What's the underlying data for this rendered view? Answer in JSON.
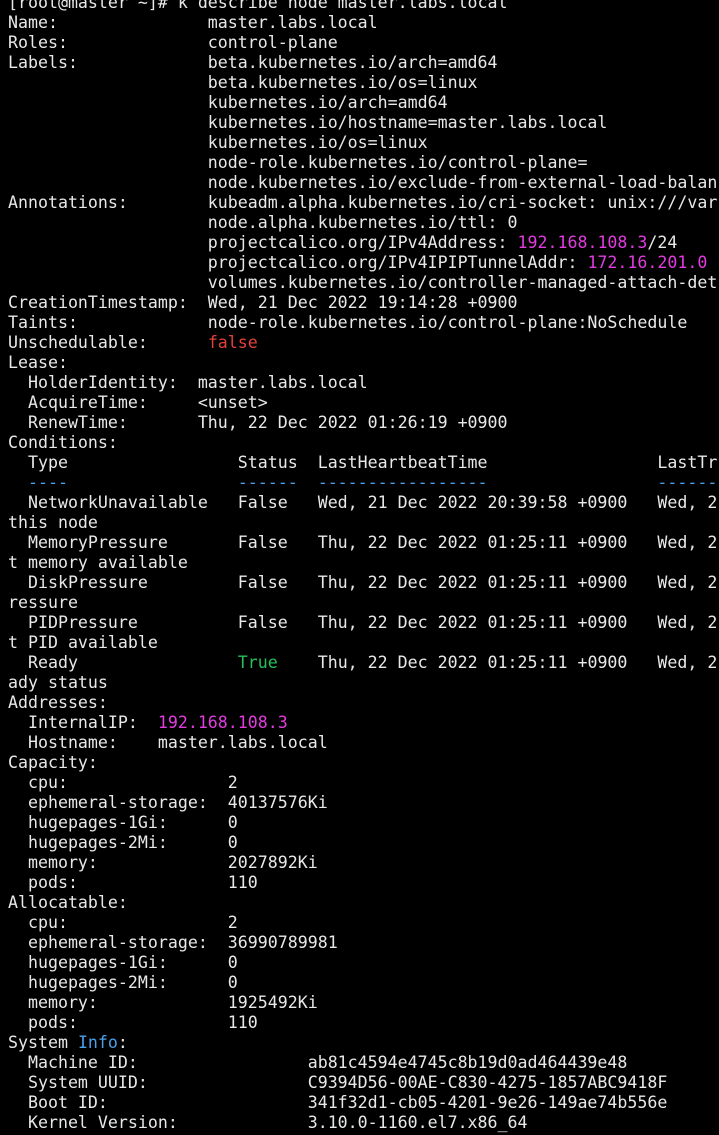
{
  "terminal": {
    "lines": [
      [
        {
          "t": "[root@master ~]# k describe node master.labs.local",
          "c": "plain"
        }
      ],
      [
        {
          "t": "Name:               master.labs.local",
          "c": "plain"
        }
      ],
      [
        {
          "t": "Roles:              control-plane",
          "c": "plain"
        }
      ],
      [
        {
          "t": "Labels:             beta.kubernetes.io/arch=amd64",
          "c": "plain"
        }
      ],
      [
        {
          "t": "                    beta.kubernetes.io/os=linux",
          "c": "plain"
        }
      ],
      [
        {
          "t": "                    kubernetes.io/arch=amd64",
          "c": "plain"
        }
      ],
      [
        {
          "t": "                    kubernetes.io/hostname=master.labs.local",
          "c": "plain"
        }
      ],
      [
        {
          "t": "                    kubernetes.io/os=linux",
          "c": "plain"
        }
      ],
      [
        {
          "t": "                    node-role.kubernetes.io/control-plane=",
          "c": "plain"
        }
      ],
      [
        {
          "t": "                    node.kubernetes.io/exclude-from-external-load-balan",
          "c": "plain"
        }
      ],
      [
        {
          "t": "Annotations:        kubeadm.alpha.kubernetes.io/cri-socket: unix:///var",
          "c": "plain"
        }
      ],
      [
        {
          "t": "                    node.alpha.kubernetes.io/ttl: 0",
          "c": "plain"
        }
      ],
      [
        {
          "t": "                    projectcalico.org/IPv4Address: ",
          "c": "plain"
        },
        {
          "t": "192.168.108.3",
          "c": "magenta"
        },
        {
          "t": "/24",
          "c": "plain"
        }
      ],
      [
        {
          "t": "                    projectcalico.org/IPv4IPIPTunnelAddr: ",
          "c": "plain"
        },
        {
          "t": "172.16.201.0",
          "c": "magenta"
        }
      ],
      [
        {
          "t": "                    volumes.kubernetes.io/controller-managed-attach-det",
          "c": "plain"
        }
      ],
      [
        {
          "t": "CreationTimestamp:  Wed, 21 Dec 2022 19:14:28 +0900",
          "c": "plain"
        }
      ],
      [
        {
          "t": "Taints:             node-role.kubernetes.io/control-plane:NoSchedule",
          "c": "plain"
        }
      ],
      [
        {
          "t": "Unschedulable:      ",
          "c": "plain"
        },
        {
          "t": "false",
          "c": "red"
        }
      ],
      [
        {
          "t": "Lease:",
          "c": "plain"
        }
      ],
      [
        {
          "t": "  HolderIdentity:  master.labs.local",
          "c": "plain"
        }
      ],
      [
        {
          "t": "  AcquireTime:     <unset>",
          "c": "plain"
        }
      ],
      [
        {
          "t": "  RenewTime:       Thu, 22 Dec 2022 01:26:19 +0900",
          "c": "plain"
        }
      ],
      [
        {
          "t": "Conditions:",
          "c": "plain"
        }
      ],
      [
        {
          "t": "  Type                 Status  LastHeartbeatTime                 LastTr",
          "c": "plain"
        }
      ],
      [
        {
          "t": "  ----                 ------  -----------------                 ------",
          "c": "blue"
        }
      ],
      [
        {
          "t": "  NetworkUnavailable   False   Wed, 21 Dec 2022 20:39:58 +0900   Wed, 2",
          "c": "plain"
        }
      ],
      [
        {
          "t": "this node",
          "c": "plain"
        }
      ],
      [
        {
          "t": "  MemoryPressure       False   Thu, 22 Dec 2022 01:25:11 +0900   Wed, 2",
          "c": "plain"
        }
      ],
      [
        {
          "t": "t memory available",
          "c": "plain"
        }
      ],
      [
        {
          "t": "  DiskPressure         False   Thu, 22 Dec 2022 01:25:11 +0900   Wed, 2",
          "c": "plain"
        }
      ],
      [
        {
          "t": "ressure",
          "c": "plain"
        }
      ],
      [
        {
          "t": "  PIDPressure          False   Thu, 22 Dec 2022 01:25:11 +0900   Wed, 2",
          "c": "plain"
        }
      ],
      [
        {
          "t": "t PID available",
          "c": "plain"
        }
      ],
      [
        {
          "t": "  Ready                ",
          "c": "plain"
        },
        {
          "t": "True",
          "c": "green"
        },
        {
          "t": "    Thu, 22 Dec 2022 01:25:11 +0900   Wed, 2",
          "c": "plain"
        }
      ],
      [
        {
          "t": "ady status",
          "c": "plain"
        }
      ],
      [
        {
          "t": "Addresses:",
          "c": "plain"
        }
      ],
      [
        {
          "t": "  InternalIP:  ",
          "c": "plain"
        },
        {
          "t": "192.168.108.3",
          "c": "magenta"
        }
      ],
      [
        {
          "t": "  Hostname:    master.labs.local",
          "c": "plain"
        }
      ],
      [
        {
          "t": "Capacity:",
          "c": "plain"
        }
      ],
      [
        {
          "t": "  cpu:                2",
          "c": "plain"
        }
      ],
      [
        {
          "t": "  ephemeral-storage:  40137576Ki",
          "c": "plain"
        }
      ],
      [
        {
          "t": "  hugepages-1Gi:      0",
          "c": "plain"
        }
      ],
      [
        {
          "t": "  hugepages-2Mi:      0",
          "c": "plain"
        }
      ],
      [
        {
          "t": "  memory:             2027892Ki",
          "c": "plain"
        }
      ],
      [
        {
          "t": "  pods:               110",
          "c": "plain"
        }
      ],
      [
        {
          "t": "Allocatable:",
          "c": "plain"
        }
      ],
      [
        {
          "t": "  cpu:                2",
          "c": "plain"
        }
      ],
      [
        {
          "t": "  ephemeral-storage:  36990789981",
          "c": "plain"
        }
      ],
      [
        {
          "t": "  hugepages-1Gi:      0",
          "c": "plain"
        }
      ],
      [
        {
          "t": "  hugepages-2Mi:      0",
          "c": "plain"
        }
      ],
      [
        {
          "t": "  memory:             1925492Ki",
          "c": "plain"
        }
      ],
      [
        {
          "t": "  pods:               110",
          "c": "plain"
        }
      ],
      [
        {
          "t": "System ",
          "c": "plain"
        },
        {
          "t": "Info",
          "c": "blue"
        },
        {
          "t": ":",
          "c": "plain"
        }
      ],
      [
        {
          "t": "  Machine ID:                 ab81c4594e4745c8b19d0ad464439e48",
          "c": "plain"
        }
      ],
      [
        {
          "t": "  System UUID:                C9394D56-00AE-C830-4275-1857ABC9418F",
          "c": "plain"
        }
      ],
      [
        {
          "t": "  Boot ID:                    341f32d1-cb05-4201-9e26-149ae74b556e",
          "c": "plain"
        }
      ],
      [
        {
          "t": "  Kernel Version:             3.10.0-1160.el7.x86_64",
          "c": "plain"
        }
      ]
    ]
  }
}
